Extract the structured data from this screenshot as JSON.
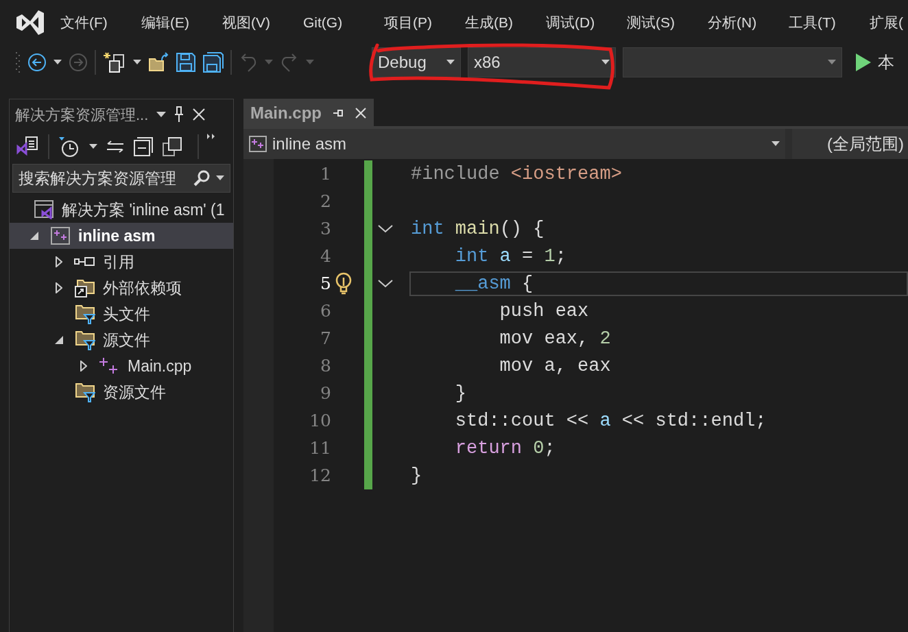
{
  "menu": [
    "文件(F)",
    "编辑(E)",
    "视图(V)",
    "Git(G)",
    "项目(P)",
    "生成(B)",
    "调试(D)",
    "测试(S)",
    "分析(N)",
    "工具(T)",
    "扩展("
  ],
  "toolbar": {
    "configuration": "Debug",
    "platform": "x86",
    "run_label": "本"
  },
  "solution_explorer": {
    "title": "解决方案资源管理...",
    "search_placeholder": "搜索解决方案资源管理",
    "tree": [
      {
        "label": "解决方案 'inline asm' (1",
        "kind": "solution",
        "selected": false,
        "children": [
          {
            "label": "inline asm",
            "kind": "project",
            "selected": true,
            "expanded": true,
            "children": [
              {
                "label": "引用",
                "kind": "references",
                "selected": false,
                "expanded": false
              },
              {
                "label": "外部依赖项",
                "kind": "external",
                "selected": false,
                "expanded": false
              },
              {
                "label": "头文件",
                "kind": "filter",
                "selected": false
              },
              {
                "label": "源文件",
                "kind": "filter",
                "selected": false,
                "expanded": true,
                "children": [
                  {
                    "label": "Main.cpp",
                    "kind": "cpp",
                    "selected": false,
                    "expanded": false
                  }
                ]
              },
              {
                "label": "资源文件",
                "kind": "filter",
                "selected": false
              }
            ]
          }
        ]
      }
    ]
  },
  "editor": {
    "tab": "Main.cpp",
    "nav_project": "inline asm",
    "nav_scope": "(全局范围)",
    "lines": [
      {
        "number": "1",
        "current": false,
        "fold": false,
        "tokens": [
          {
            "text": "#include ",
            "kind": "preprocessor"
          },
          {
            "text": "<iostream>",
            "kind": "string"
          }
        ]
      },
      {
        "number": "2",
        "current": false,
        "fold": false
      },
      {
        "number": "3",
        "current": false,
        "fold": true,
        "tokens": [
          {
            "text": "int",
            "kind": "keyword"
          },
          {
            "text": " main",
            "kind": "function"
          },
          {
            "text": "() {",
            "kind": "plain"
          }
        ]
      },
      {
        "number": "4",
        "current": false,
        "fold": false,
        "tokens": [
          {
            "text": "    int",
            "kind": "keyword"
          },
          {
            "text": " a",
            "kind": "variable"
          },
          {
            "text": " = ",
            "kind": "plain"
          },
          {
            "text": "1",
            "kind": "number"
          },
          {
            "text": ";",
            "kind": "plain"
          }
        ]
      },
      {
        "number": "5",
        "current": true,
        "fold": true,
        "tokens": [
          {
            "text": "    __asm",
            "kind": "keyword"
          },
          {
            "text": " {",
            "kind": "plain"
          }
        ]
      },
      {
        "number": "6",
        "current": false,
        "fold": false,
        "tokens": [
          {
            "text": "        push eax",
            "kind": "plain"
          }
        ]
      },
      {
        "number": "7",
        "current": false,
        "fold": false,
        "tokens": [
          {
            "text": "        mov eax, ",
            "kind": "plain"
          },
          {
            "text": "2",
            "kind": "number"
          }
        ]
      },
      {
        "number": "8",
        "current": false,
        "fold": false,
        "tokens": [
          {
            "text": "        mov a, eax",
            "kind": "plain"
          }
        ]
      },
      {
        "number": "9",
        "current": false,
        "fold": false,
        "tokens": [
          {
            "text": "    }",
            "kind": "plain"
          }
        ]
      },
      {
        "number": "10",
        "current": false,
        "fold": false,
        "tokens": [
          {
            "text": "    std::cout << ",
            "kind": "plain"
          },
          {
            "text": "a",
            "kind": "variable"
          },
          {
            "text": " << std::endl;",
            "kind": "plain"
          }
        ]
      },
      {
        "number": "11",
        "current": false,
        "fold": false,
        "tokens": [
          {
            "text": "    return",
            "kind": "control"
          },
          {
            "text": " 0",
            "kind": "number"
          },
          {
            "text": ";",
            "kind": "plain"
          }
        ]
      },
      {
        "number": "12",
        "current": false,
        "fold": false,
        "tokens": [
          {
            "text": "}",
            "kind": "plain"
          }
        ]
      }
    ]
  }
}
